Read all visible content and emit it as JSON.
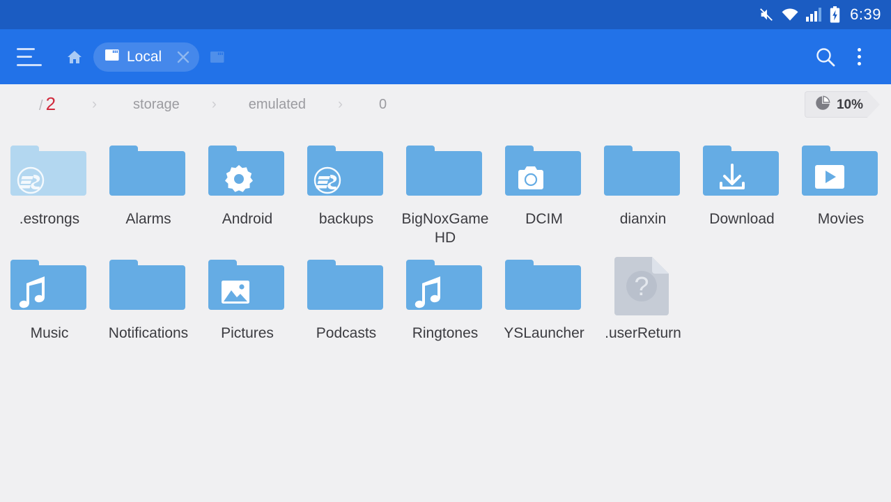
{
  "statusbar": {
    "time": "6:39",
    "icons": [
      "mute-icon",
      "wifi-icon",
      "signal-icon",
      "battery-charging-icon"
    ]
  },
  "toolbar": {
    "menu_icon": "hamburger-menu-icon",
    "home_icon": "home-icon",
    "tab": {
      "icon": "sdcard-icon",
      "label": "Local",
      "close_icon": "close-icon"
    },
    "new_tab_icon": "new-tab-icon",
    "search_icon": "search-icon",
    "overflow_icon": "more-vertical-icon",
    "accent_color": "#2272e8",
    "statusbar_color": "#1b5cc2"
  },
  "breadcrumb": {
    "root_slash": "/",
    "root_count": "2",
    "separator": "›",
    "items": [
      "storage",
      "emulated",
      "0"
    ]
  },
  "storage": {
    "icon": "pie-chart-icon",
    "percent": "10%"
  },
  "grid": {
    "folder_color": "#65ace4",
    "items": [
      {
        "name": ".estrongs",
        "type": "folder",
        "badge": "es-logo-icon",
        "hidden": true
      },
      {
        "name": "Alarms",
        "type": "folder",
        "badge": null,
        "hidden": false
      },
      {
        "name": "Android",
        "type": "folder",
        "badge": "gear-icon",
        "hidden": false
      },
      {
        "name": "backups",
        "type": "folder",
        "badge": "es-logo-icon",
        "hidden": false
      },
      {
        "name": "BigNoxGameHD",
        "type": "folder",
        "badge": null,
        "hidden": false
      },
      {
        "name": "DCIM",
        "type": "folder",
        "badge": "camera-icon",
        "hidden": false
      },
      {
        "name": "dianxin",
        "type": "folder",
        "badge": null,
        "hidden": false
      },
      {
        "name": "Download",
        "type": "folder",
        "badge": "download-icon",
        "hidden": false
      },
      {
        "name": "Movies",
        "type": "folder",
        "badge": "play-icon",
        "hidden": false
      },
      {
        "name": "Music",
        "type": "folder",
        "badge": "music-note-icon",
        "hidden": false
      },
      {
        "name": "Notifications",
        "type": "folder",
        "badge": null,
        "hidden": false
      },
      {
        "name": "Pictures",
        "type": "folder",
        "badge": "image-icon",
        "hidden": false
      },
      {
        "name": "Podcasts",
        "type": "folder",
        "badge": null,
        "hidden": false
      },
      {
        "name": "Ringtones",
        "type": "folder",
        "badge": "music-note-icon",
        "hidden": false
      },
      {
        "name": "YSLauncher",
        "type": "folder",
        "badge": null,
        "hidden": false
      },
      {
        "name": ".userReturn",
        "type": "file",
        "badge": "question-mark-icon",
        "hidden": true
      }
    ]
  }
}
